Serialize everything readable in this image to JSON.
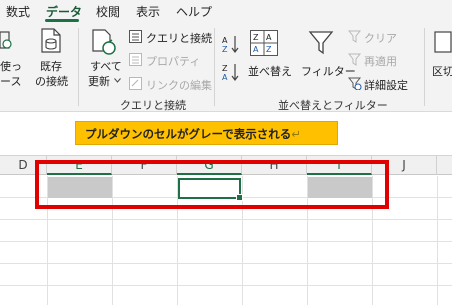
{
  "tabs": [
    {
      "label": "数式"
    },
    {
      "label": "データ",
      "active": true
    },
    {
      "label": "校閲"
    },
    {
      "label": "表示"
    },
    {
      "label": "ヘルプ"
    }
  ],
  "ribbon": {
    "partial_left": {
      "line1": "使っ",
      "line2": "ース"
    },
    "existing_connection": {
      "line1": "既存",
      "line2": "の接続"
    },
    "refresh_all": {
      "line1": "すべて",
      "line2": "更新"
    },
    "queries": {
      "queries_connections": "クエリと接続",
      "properties": "プロパティ",
      "edit_links": "リンクの編集",
      "group_label": "クエリと接続"
    },
    "sort_filter": {
      "sort": "並べ替え",
      "filter": "フィルター",
      "clear": "クリア",
      "reapply": "再適用",
      "advanced": "詳細設定",
      "group_label": "並べ替えとフィルター"
    },
    "partial_right": "区切"
  },
  "callout": {
    "text": "プルダウンのセルがグレーで表示される",
    "mark": "↵"
  },
  "columns": [
    "D",
    "E",
    "F",
    "G",
    "H",
    "I",
    "J"
  ],
  "colors": {
    "accent": "#1e7145",
    "highlight_box": "#e00000",
    "callout_bg": "#ffc000",
    "grey_cell": "#c9c9c9"
  }
}
